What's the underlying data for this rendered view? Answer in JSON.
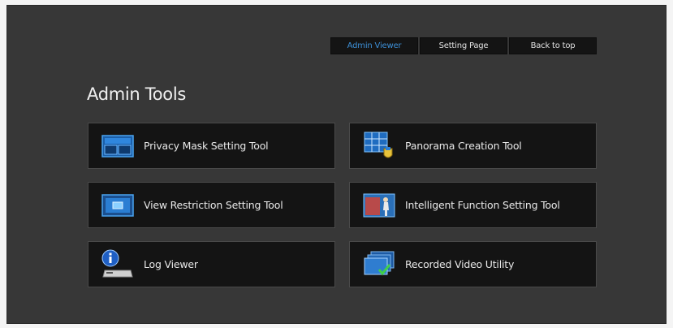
{
  "nav": {
    "items": [
      {
        "label": "Admin Viewer",
        "active": true
      },
      {
        "label": "Setting Page",
        "active": false
      },
      {
        "label": "Back to top",
        "active": false
      }
    ],
    "active_color": "#3d8fd6"
  },
  "page": {
    "title": "Admin Tools"
  },
  "tools": [
    {
      "label": "Privacy Mask Setting Tool",
      "icon": "privacy-mask-icon"
    },
    {
      "label": "Panorama Creation Tool",
      "icon": "panorama-grid-icon"
    },
    {
      "label": "View Restriction Setting Tool",
      "icon": "view-restriction-icon"
    },
    {
      "label": "Intelligent Function Setting Tool",
      "icon": "intelligent-function-icon"
    },
    {
      "label": "Log Viewer",
      "icon": "log-viewer-icon"
    },
    {
      "label": "Recorded Video Utility",
      "icon": "recorded-video-icon"
    }
  ]
}
